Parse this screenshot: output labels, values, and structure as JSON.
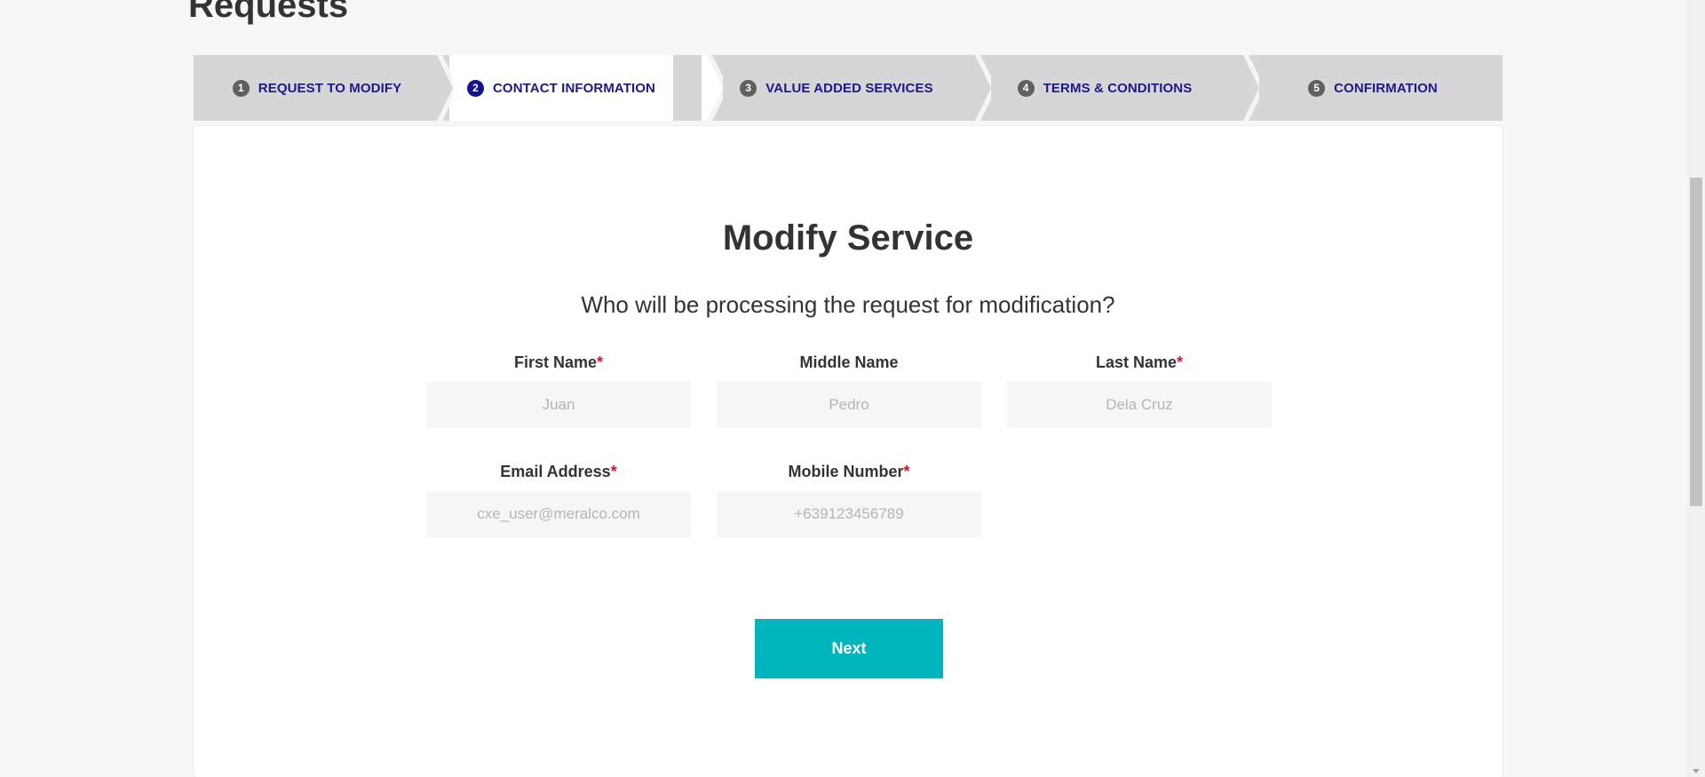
{
  "page": {
    "title": "Requests"
  },
  "stepper": {
    "steps": [
      {
        "number": "1",
        "label": "REQUEST TO MODIFY"
      },
      {
        "number": "2",
        "label": "CONTACT INFORMATION"
      },
      {
        "number": "3",
        "label": "VALUE ADDED SERVICES"
      },
      {
        "number": "4",
        "label": "TERMS & CONDITIONS"
      },
      {
        "number": "5",
        "label": "CONFIRMATION"
      }
    ],
    "active_step": "2"
  },
  "form": {
    "title": "Modify Service",
    "subtitle": "Who will be processing the request for modification?",
    "required_mark": "*",
    "fields": {
      "first_name": {
        "label": "First Name",
        "placeholder": "Juan",
        "value": "",
        "required": true
      },
      "middle_name": {
        "label": "Middle Name",
        "placeholder": "Pedro",
        "value": "",
        "required": false
      },
      "last_name": {
        "label": "Last Name",
        "placeholder": "Dela Cruz",
        "value": "",
        "required": true
      },
      "email": {
        "label": "Email Address",
        "placeholder": "cxe_user@meralco.com",
        "value": "",
        "required": true
      },
      "mobile": {
        "label": "Mobile Number",
        "placeholder": "+639123456789",
        "value": "",
        "required": true
      }
    },
    "next_label": "Next"
  },
  "colors": {
    "accent": "#00b5bd",
    "step_text": "#1a1a8c",
    "required": "#e0102c"
  }
}
